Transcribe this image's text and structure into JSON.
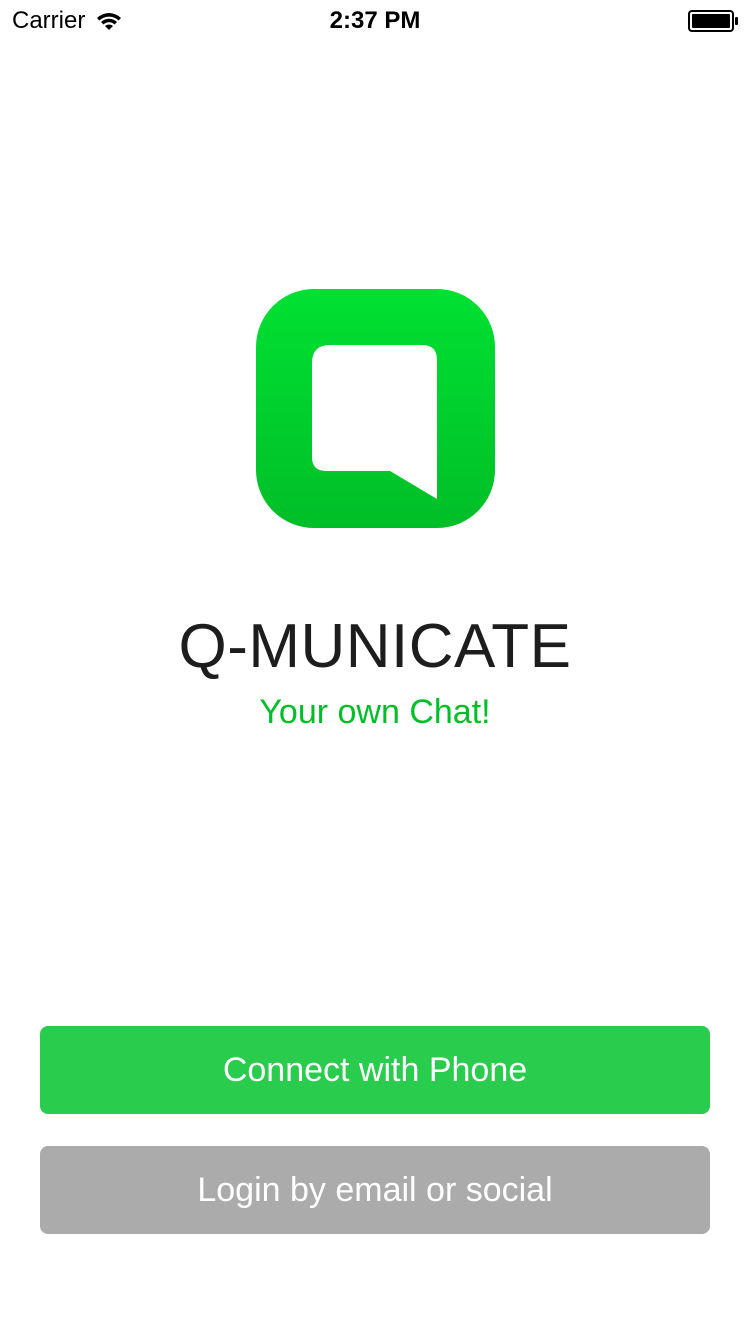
{
  "status_bar": {
    "carrier": "Carrier",
    "time": "2:37 PM",
    "wifi_icon": "wifi-icon",
    "battery_icon": "battery-icon"
  },
  "logo": {
    "icon": "chat-bubble-icon",
    "gradient_top": "#00E132",
    "gradient_bottom": "#00BE28"
  },
  "app": {
    "title": "Q-MUNICATE",
    "subtitle": "Your own Chat!"
  },
  "buttons": {
    "phone_label": "Connect with Phone",
    "email_label": "Login by email or social"
  },
  "colors": {
    "accent": "#00BE28",
    "phone_button": "#29CC4C",
    "email_button": "#ABABAB",
    "title_text": "#1D1D1D"
  }
}
